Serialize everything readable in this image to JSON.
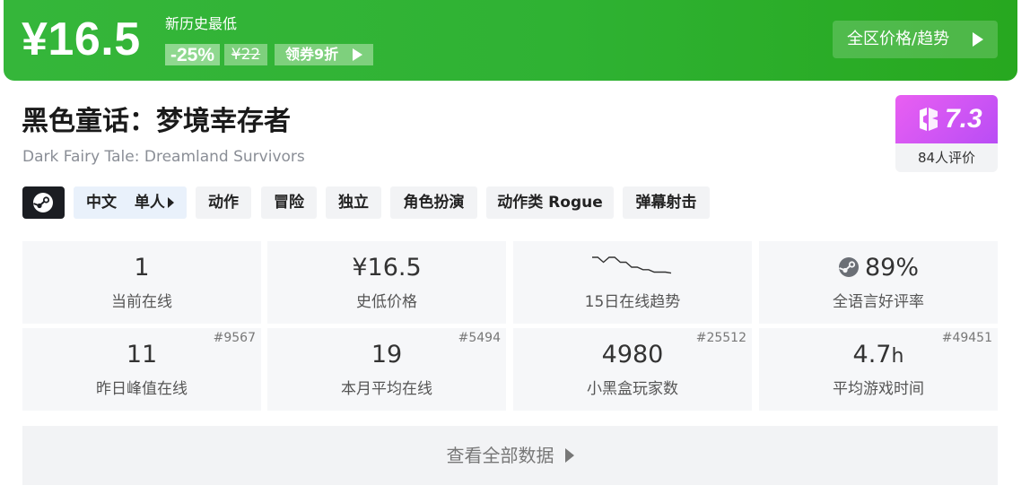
{
  "banner": {
    "price": "¥16.5",
    "low_label": "新历史最低",
    "discount": "-25%",
    "original_price": "¥22",
    "coupon": "领券9折",
    "region_button": "全区价格/趋势",
    "colors": {
      "banner": "#2fb233",
      "badge": "#8fd88f"
    }
  },
  "game": {
    "title_cn": "黑色童话：梦境幸存者",
    "title_en": "Dark Fairy Tale: Dreamland Survivors"
  },
  "score": {
    "value": "7.3",
    "count_label": "84人评价",
    "color": "#d657f3"
  },
  "tags": {
    "platform_icon": "steam-icon",
    "language": "中文",
    "mode": "单人",
    "items": [
      "动作",
      "冒险",
      "独立",
      "角色扮演",
      "动作类 Rogue",
      "弹幕射击"
    ]
  },
  "stats": {
    "current_online": {
      "value": "1",
      "label": "当前在线"
    },
    "lowest_price": {
      "value": "¥16.5",
      "label": "史低价格"
    },
    "trend": {
      "label": "15日在线趋势",
      "series": [
        4,
        4,
        3,
        4,
        4,
        3,
        3,
        2,
        2,
        1.5,
        1.5,
        1,
        1,
        1,
        0.8
      ]
    },
    "positive_rate": {
      "value": "89%",
      "label": "全语言好评率",
      "icon": "steam-icon"
    },
    "yesterday_peak": {
      "value": "11",
      "label": "昨日峰值在线",
      "rank": "#9567"
    },
    "monthly_avg": {
      "value": "19",
      "label": "本月平均在线",
      "rank": "#5494"
    },
    "heybox_players": {
      "value": "4980",
      "label": "小黑盒玩家数",
      "rank": "#25512"
    },
    "avg_playtime": {
      "value": "4.7",
      "unit": "h",
      "label": "平均游戏时间",
      "rank": "#49451"
    }
  },
  "more_button": "查看全部数据"
}
